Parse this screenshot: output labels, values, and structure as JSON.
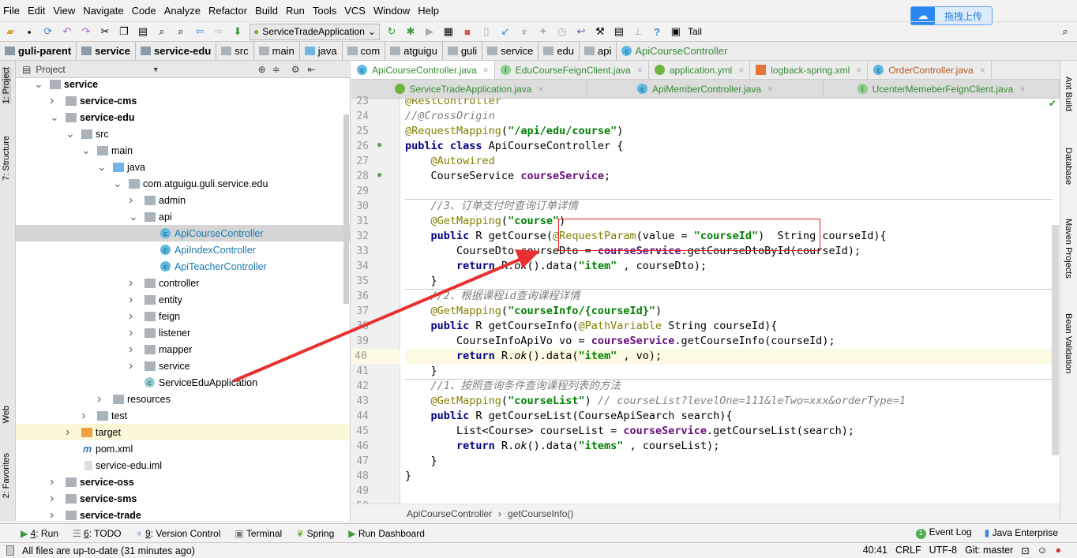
{
  "menu": [
    "File",
    "Edit",
    "View",
    "Navigate",
    "Code",
    "Analyze",
    "Refactor",
    "Build",
    "Run",
    "Tools",
    "VCS",
    "Window",
    "Help"
  ],
  "upload": {
    "label": "拖拽上传"
  },
  "toolbar": {
    "run_config": "ServiceTradeApplication",
    "tail": "Tail"
  },
  "breadcrumbs": [
    "guli-parent",
    "service",
    "service-edu",
    "src",
    "main",
    "java",
    "com",
    "atguigu",
    "guli",
    "service",
    "edu",
    "api",
    "ApiCourseController"
  ],
  "left_tabs": [
    "1: Project",
    "7: Structure",
    "Web",
    "2: Favorites"
  ],
  "right_tabs": [
    "Ant Build",
    "Database",
    "Maven Projects",
    "Bean Validation"
  ],
  "project": {
    "title": "Project",
    "tree": [
      {
        "label": "service",
        "level": 0,
        "arrow": "open",
        "bold": true,
        "icon": "module"
      },
      {
        "label": "service-cms",
        "level": 1,
        "arrow": "closed",
        "bold": true,
        "icon": "module"
      },
      {
        "label": "service-edu",
        "level": 1,
        "arrow": "open",
        "bold": true,
        "icon": "module"
      },
      {
        "label": "src",
        "level": 2,
        "arrow": "open",
        "icon": "folder"
      },
      {
        "label": "main",
        "level": 3,
        "arrow": "open",
        "icon": "folder"
      },
      {
        "label": "java",
        "level": 4,
        "arrow": "open",
        "icon": "source"
      },
      {
        "label": "com.atguigu.guli.service.edu",
        "level": 5,
        "arrow": "open",
        "icon": "package"
      },
      {
        "label": "admin",
        "level": 6,
        "arrow": "closed",
        "icon": "package"
      },
      {
        "label": "api",
        "level": 6,
        "arrow": "open",
        "icon": "package"
      },
      {
        "label": "ApiCourseController",
        "level": 7,
        "icon": "class",
        "selected": true
      },
      {
        "label": "ApiIndexController",
        "level": 7,
        "icon": "class"
      },
      {
        "label": "ApiTeacherController",
        "level": 7,
        "icon": "class"
      },
      {
        "label": "controller",
        "level": 6,
        "arrow": "closed",
        "icon": "package"
      },
      {
        "label": "entity",
        "level": 6,
        "arrow": "closed",
        "icon": "package"
      },
      {
        "label": "feign",
        "level": 6,
        "arrow": "closed",
        "icon": "package"
      },
      {
        "label": "listener",
        "level": 6,
        "arrow": "closed",
        "icon": "package"
      },
      {
        "label": "mapper",
        "level": 6,
        "arrow": "closed",
        "icon": "package"
      },
      {
        "label": "service",
        "level": 6,
        "arrow": "closed",
        "icon": "package"
      },
      {
        "label": "ServiceEduApplication",
        "level": 6,
        "icon": "spring-class"
      },
      {
        "label": "resources",
        "level": 4,
        "arrow": "closed",
        "icon": "folder"
      },
      {
        "label": "test",
        "level": 3,
        "arrow": "closed",
        "icon": "folder"
      },
      {
        "label": "target",
        "level": 2,
        "arrow": "closed",
        "icon": "target-folder",
        "highlight": true
      },
      {
        "label": "pom.xml",
        "level": 2,
        "icon": "maven"
      },
      {
        "label": "service-edu.iml",
        "level": 2,
        "icon": "file"
      },
      {
        "label": "service-oss",
        "level": 1,
        "arrow": "closed",
        "bold": true,
        "icon": "module"
      },
      {
        "label": "service-sms",
        "level": 1,
        "arrow": "closed",
        "bold": true,
        "icon": "module"
      },
      {
        "label": "service-trade",
        "level": 1,
        "arrow": "closed",
        "bold": true,
        "icon": "module"
      }
    ]
  },
  "tabs_row1": [
    {
      "label": "ApiCourseController.java",
      "kind": "class",
      "active": true,
      "color": "green"
    },
    {
      "label": "EduCourseFeignClient.java",
      "kind": "interface",
      "color": "green"
    },
    {
      "label": "application.yml",
      "kind": "spring",
      "color": "green"
    },
    {
      "label": "logback-spring.xml",
      "kind": "xml",
      "color": "green"
    },
    {
      "label": "OrderController.java",
      "kind": "class",
      "color": "orange"
    }
  ],
  "tabs_row2": [
    {
      "label": "ServiceTradeApplication.java",
      "kind": "spring",
      "color": "green"
    },
    {
      "label": "ApiMemberController.java",
      "kind": "class",
      "color": "green"
    },
    {
      "label": "UcenterMemeberFeignClient.java",
      "kind": "interface",
      "color": "green"
    }
  ],
  "editor": {
    "first_line": 23,
    "current_line": 40,
    "lines": [
      [
        [
          "an",
          "@RestController"
        ]
      ],
      [
        [
          "cm",
          "//@CrossOrigin"
        ]
      ],
      [
        [
          "an",
          "@RequestMapping"
        ],
        [
          "",
          "("
        ],
        [
          "str",
          "\"/api/edu/course\""
        ],
        [
          "",
          ")"
        ]
      ],
      [
        [
          "kw",
          "public class "
        ],
        [
          "",
          "ApiCourseController {"
        ]
      ],
      [
        [
          "",
          "    "
        ],
        [
          "an",
          "@Autowired"
        ]
      ],
      [
        [
          "",
          "    CourseService "
        ],
        [
          "fld",
          "courseService"
        ],
        [
          "",
          ";"
        ]
      ],
      [],
      [
        [
          "",
          "    "
        ],
        [
          "cm",
          "//3、订单支付时查询订单详情"
        ]
      ],
      [
        [
          "",
          "    "
        ],
        [
          "an",
          "@GetMapping"
        ],
        [
          "",
          "("
        ],
        [
          "str",
          "\"course\""
        ],
        [
          "",
          ")"
        ]
      ],
      [
        [
          "",
          "    "
        ],
        [
          "kw",
          "public "
        ],
        [
          "",
          "R getCourse("
        ],
        [
          "an",
          "@RequestParam"
        ],
        [
          "",
          "(value = "
        ],
        [
          "str",
          "\"courseId\""
        ],
        [
          "",
          ")  String courseId){"
        ]
      ],
      [
        [
          "",
          "        CourseDto courseDto = "
        ],
        [
          "fld",
          "courseService"
        ],
        [
          "",
          ".getCourseDtoById(courseId);"
        ]
      ],
      [
        [
          "",
          "        "
        ],
        [
          "kw",
          "return "
        ],
        [
          "",
          "R."
        ],
        [
          "it",
          "ok"
        ],
        [
          "",
          "().data("
        ],
        [
          "str",
          "\"item\""
        ],
        [
          "",
          " , courseDto);"
        ]
      ],
      [
        [
          "",
          "    }"
        ]
      ],
      [
        [
          "",
          "    "
        ],
        [
          "cm",
          "//2、根据课程id查询课程详情"
        ]
      ],
      [
        [
          "",
          "    "
        ],
        [
          "an",
          "@GetMapping"
        ],
        [
          "",
          "("
        ],
        [
          "str",
          "\"courseInfo/{courseId}\""
        ],
        [
          "",
          ")"
        ]
      ],
      [
        [
          "",
          "    "
        ],
        [
          "kw",
          "public "
        ],
        [
          "",
          "R getCourseInfo("
        ],
        [
          "an",
          "@PathVariable"
        ],
        [
          "",
          " String courseId){"
        ]
      ],
      [
        [
          "",
          "        CourseInfoApiVo vo = "
        ],
        [
          "fld",
          "courseService"
        ],
        [
          "",
          ".getCourseInfo(courseId);"
        ]
      ],
      [
        [
          "",
          "        "
        ],
        [
          "kw",
          "return "
        ],
        [
          "",
          "R."
        ],
        [
          "it",
          "ok"
        ],
        [
          "",
          "().data("
        ],
        [
          "str",
          "\"item\""
        ],
        [
          "",
          " , vo);"
        ]
      ],
      [
        [
          "",
          "    }"
        ]
      ],
      [
        [
          "",
          "    "
        ],
        [
          "cm",
          "//1、按照查询条件查询课程列表的方法"
        ]
      ],
      [
        [
          "",
          "    "
        ],
        [
          "an",
          "@GetMapping"
        ],
        [
          "",
          "("
        ],
        [
          "str",
          "\"courseList\""
        ],
        [
          "",
          ") "
        ],
        [
          "cm",
          "// courseList?levelOne=111&leTwo=xxx&orderType=1"
        ]
      ],
      [
        [
          "",
          "    "
        ],
        [
          "kw",
          "public "
        ],
        [
          "",
          "R getCourseList(CourseApiSearch search){"
        ]
      ],
      [
        [
          "",
          "        List<Course> courseList = "
        ],
        [
          "fld",
          "courseService"
        ],
        [
          "",
          ".getCourseList(search);"
        ]
      ],
      [
        [
          "",
          "        "
        ],
        [
          "kw",
          "return "
        ],
        [
          "",
          "R."
        ],
        [
          "it",
          "ok"
        ],
        [
          "",
          "().data("
        ],
        [
          "str",
          "\"items\""
        ],
        [
          "",
          " , courseList);"
        ]
      ],
      [
        [
          "",
          "    }"
        ]
      ],
      [
        [
          "",
          "}"
        ]
      ],
      [],
      []
    ]
  },
  "code_breadcrumb": [
    "ApiCourseController",
    "getCourseInfo()"
  ],
  "tool_windows": [
    {
      "key": "4",
      "label": ": Run"
    },
    {
      "key": "6",
      "label": ": TODO"
    },
    {
      "key": "9",
      "label": ": Version Control"
    },
    {
      "key": "",
      "label": "Terminal"
    },
    {
      "key": "",
      "label": "Spring"
    },
    {
      "key": "",
      "label": "Run Dashboard"
    }
  ],
  "tool_windows_right": [
    "Event Log",
    "Java Enterprise"
  ],
  "event_count": "1",
  "status": {
    "message": "All files are up-to-date (31 minutes ago)",
    "position": "40:41",
    "line_sep": "CRLF",
    "encoding": "UTF-8",
    "git": "Git: master"
  },
  "colors": {
    "annotation_box": "#e02020",
    "arrow": "#e83030",
    "selection": "#d5d5d5"
  }
}
